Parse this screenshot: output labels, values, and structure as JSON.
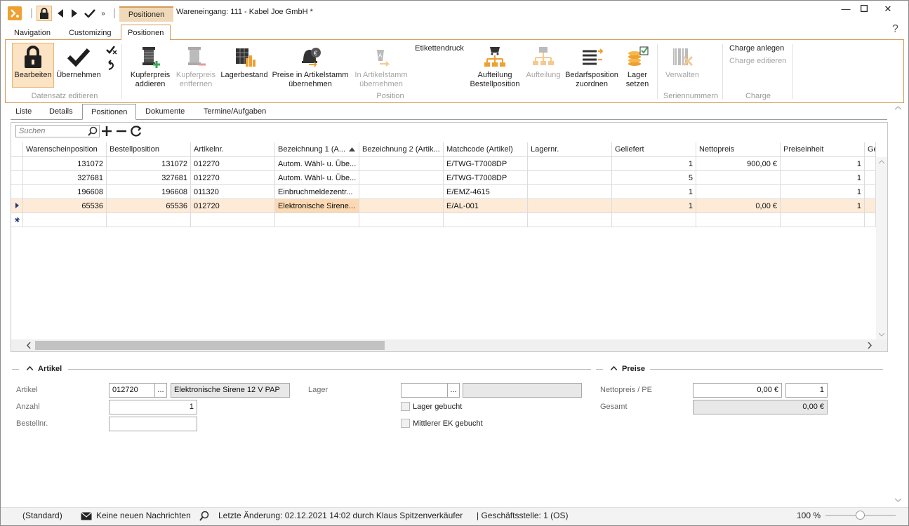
{
  "window": {
    "title": "Wareneingang: 111 - Kabel Joe GmbH *",
    "context_tab": "Positionen"
  },
  "ribbon_tabs": [
    "Navigation",
    "Customizing",
    "Positionen"
  ],
  "ribbon": {
    "groups": {
      "datensatz": "Datensatz editieren",
      "position": "Position",
      "serien": "Seriennummern",
      "charge": "Charge"
    },
    "buttons": {
      "bearbeiten": "Bearbeiten",
      "uebernehmen": "Übernehmen",
      "kupfer_add_1": "Kupferpreis",
      "kupfer_add_2": "addieren",
      "kupfer_rem_1": "Kupferpreis",
      "kupfer_rem_2": "entfernen",
      "lagerbestand": "Lagerbestand",
      "preise_1": "Preise in Artikelstamm",
      "preise_2": "übernehmen",
      "instamm_1": "In Artikelstamm",
      "instamm_2": "übernehmen",
      "etikettendruck": "Etikettendruck",
      "aufteilung_best_1": "Aufteilung",
      "aufteilung_best_2": "Bestellposition",
      "aufteilung": "Aufteilung",
      "bedarf_1": "Bedarfsposition",
      "bedarf_2": "zuordnen",
      "lager_1": "Lager",
      "lager_2": "setzen",
      "verwalten": "Verwalten",
      "charge_anlegen": "Charge anlegen",
      "charge_editieren": "Charge editieren"
    }
  },
  "doc_tabs": [
    "Liste",
    "Details",
    "Positionen",
    "Dokumente",
    "Termine/Aufgaben"
  ],
  "grid": {
    "search_placeholder": "Suchen",
    "columns": [
      "Warenscheinposition",
      "Bestellposition",
      "Artikelnr.",
      "Bezeichnung 1 (A...",
      "Bezeichnung 2 (Artik...",
      "Matchcode (Artikel)",
      "Lagernr.",
      "Geliefert",
      "Nettopreis",
      "Preiseinheit",
      "Ge"
    ],
    "rows": [
      [
        "131072",
        "131072",
        "012270",
        "Autom. Wähl- u. Übe...",
        "",
        "E/TWG-T7008DP",
        "",
        "1",
        "900,00 €",
        "1"
      ],
      [
        "327681",
        "327681",
        "012270",
        "Autom. Wähl- u. Übe...",
        "",
        "E/TWG-T7008DP",
        "",
        "5",
        "",
        "1"
      ],
      [
        "196608",
        "196608",
        "011320",
        "Einbruchmeldezentr...",
        "",
        "E/EMZ-4615",
        "",
        "1",
        "",
        "1"
      ],
      [
        "65536",
        "65536",
        "012720",
        "Elektronische Sirene...",
        "",
        "E/AL-001",
        "",
        "1",
        "0,00 €",
        "1"
      ]
    ]
  },
  "artikel_section": {
    "title": "Artikel",
    "artikel_label": "Artikel",
    "artikel_nr": "012720",
    "artikel_name": "Elektronische Sirene 12 V PAP",
    "anzahl_label": "Anzahl",
    "anzahl": "1",
    "bestellnr_label": "Bestellnr.",
    "bestellnr": "",
    "lager_label": "Lager",
    "lager_gebucht": "Lager gebucht",
    "mittlerer_ek": "Mittlerer EK gebucht",
    "ellipsis": "..."
  },
  "preise_section": {
    "title": "Preise",
    "nettopreis_label": "Nettopreis / PE",
    "nettopreis": "0,00 €",
    "pe": "1",
    "gesamt_label": "Gesamt",
    "gesamt": "0,00 €"
  },
  "status": {
    "layout": "(Standard)",
    "messages": "Keine neuen Nachrichten",
    "last_change": "Letzte Änderung: 02.12.2021 14:02 durch Klaus Spitzenverkäufer",
    "branch": "| Geschäftsstelle:  1 (OS)",
    "zoom": "100 %"
  },
  "colors": {
    "accent": "#d39b5a",
    "selected_row": "#fdebd8",
    "selected_cell": "#fcd9b2"
  }
}
